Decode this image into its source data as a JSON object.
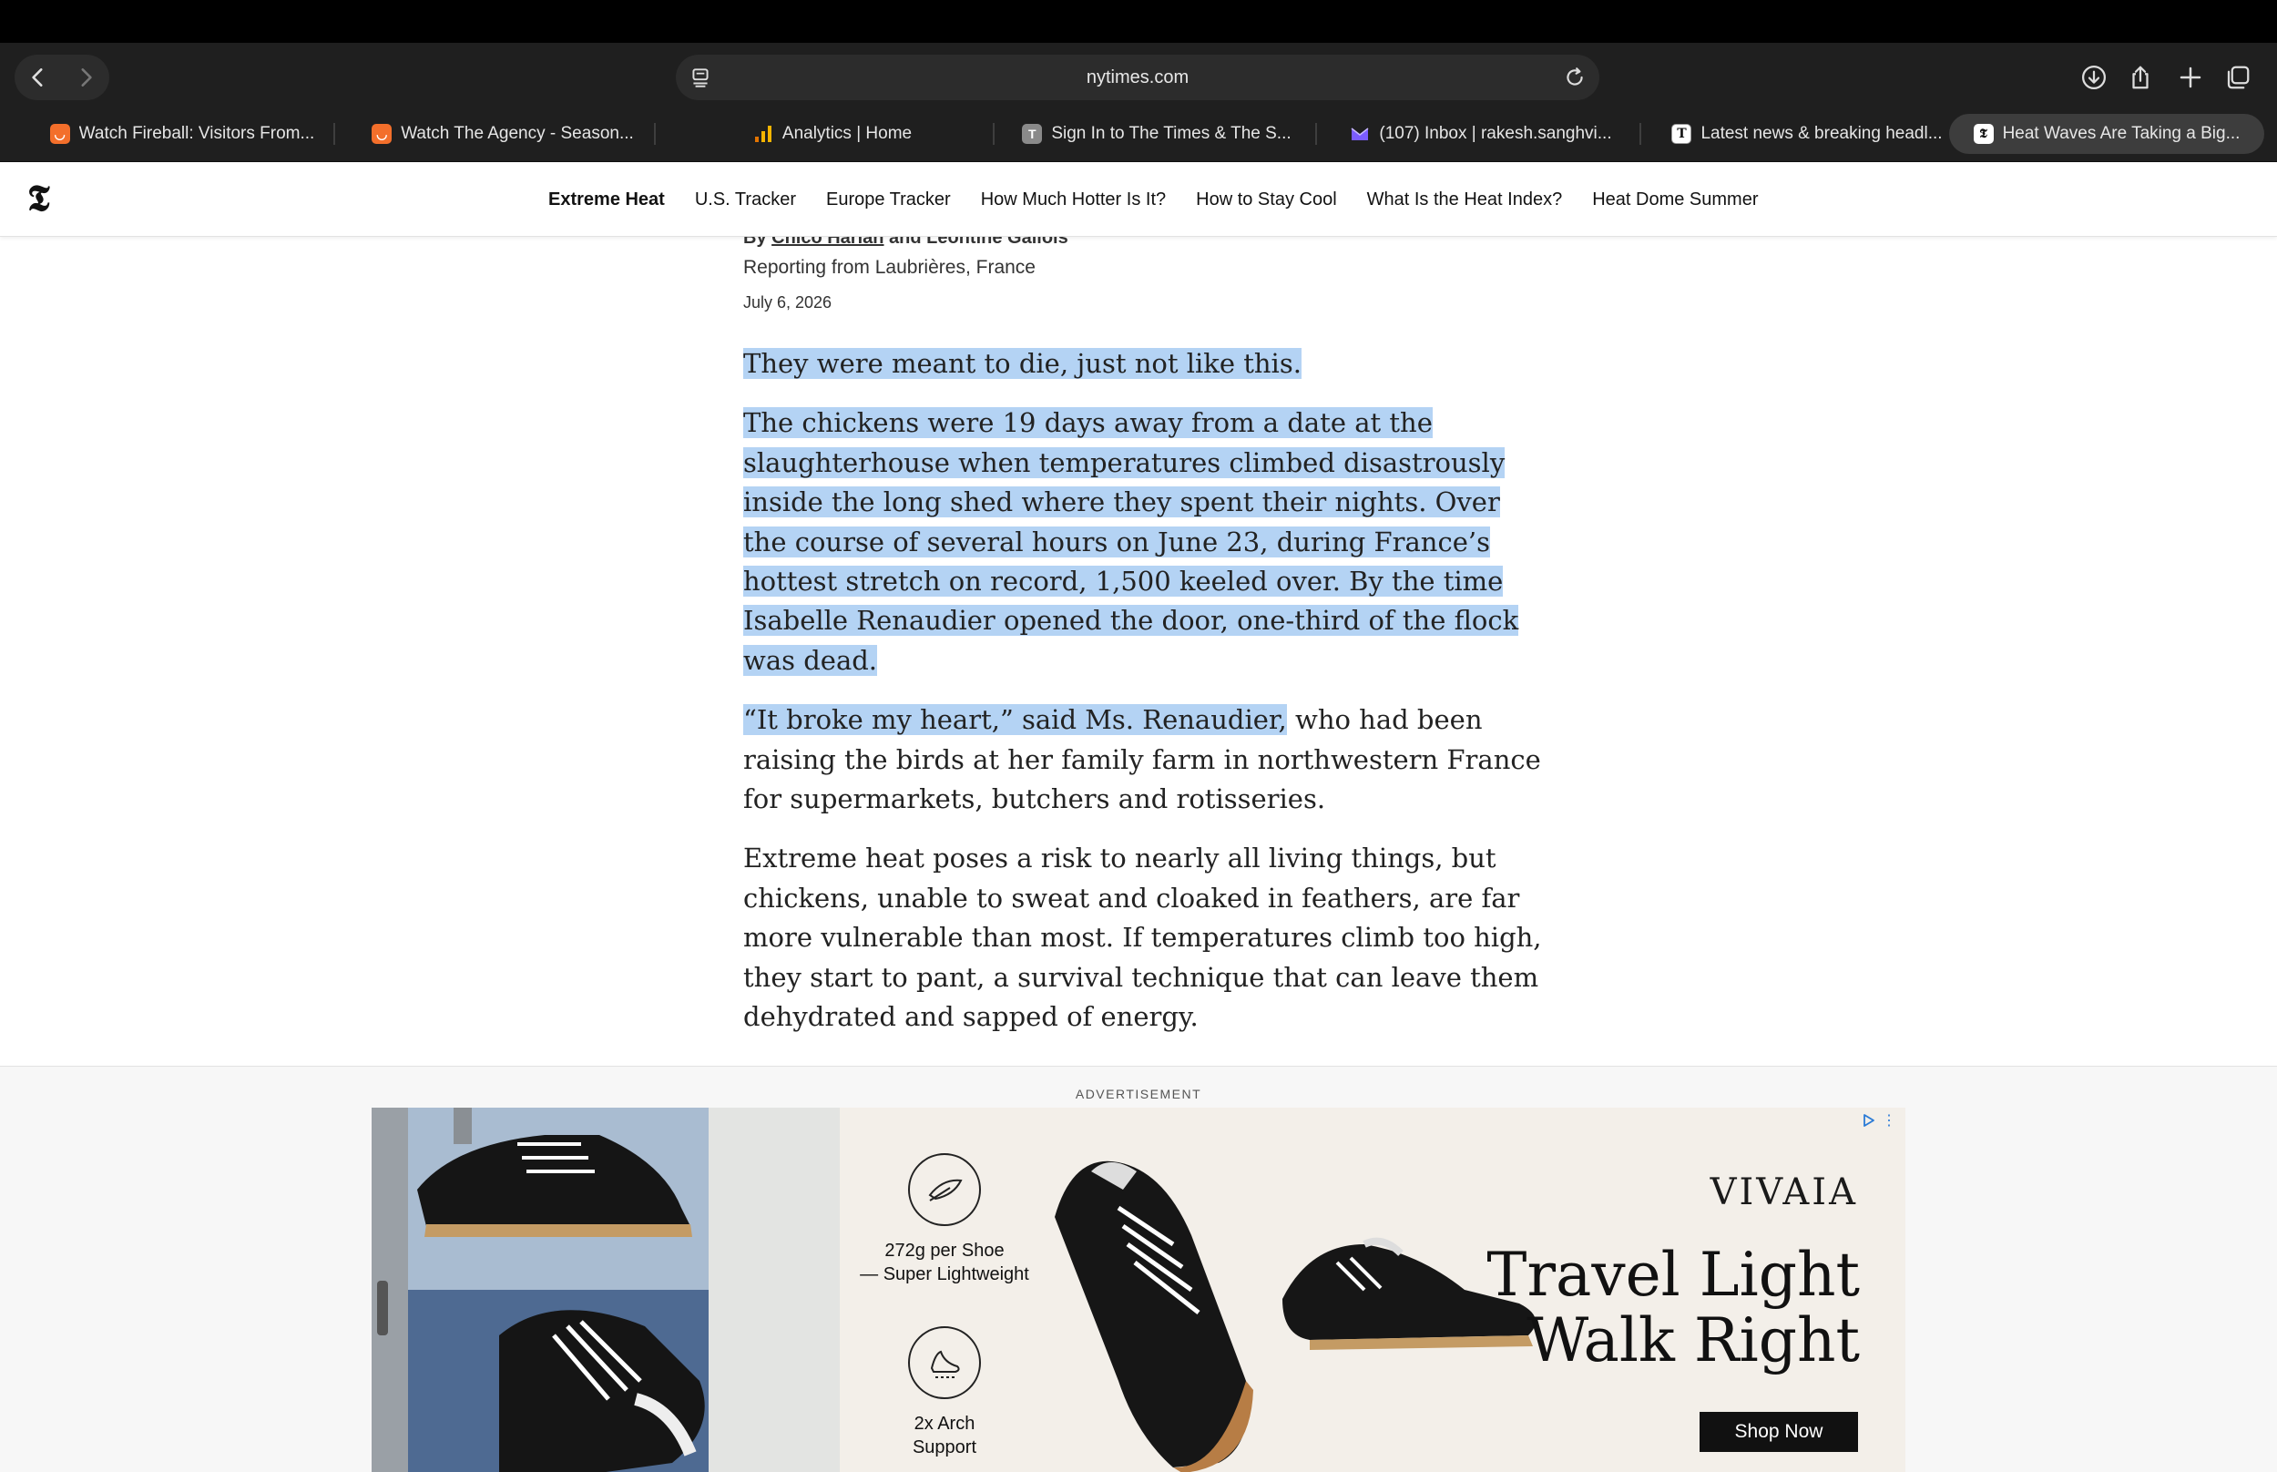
{
  "browser": {
    "url": "nytimes.com",
    "tabs": [
      {
        "label": "Watch Fireball: Visitors From...",
        "favicon": "orange-square-icon",
        "color": "#f36f2b",
        "active": false
      },
      {
        "label": "Watch The Agency - Season...",
        "favicon": "orange-square-icon",
        "color": "#f36f2b",
        "active": false
      },
      {
        "label": "Analytics | Home",
        "favicon": "analytics-bars-icon",
        "color": "#f4b400",
        "active": false
      },
      {
        "label": "Sign In to The Times & The S...",
        "favicon": "letter-t-icon",
        "color": "#8a8a8a",
        "active": false
      },
      {
        "label": "(107) Inbox | rakesh.sanghvi...",
        "favicon": "mail-m-icon",
        "color": "#7b5cff",
        "active": false
      },
      {
        "label": "Latest news & breaking headl...",
        "favicon": "letter-t-box-icon",
        "color": "#ffffff",
        "active": false
      },
      {
        "label": "Heat Waves Are Taking a Big...",
        "favicon": "nyt-logo-icon",
        "color": "#ffffff",
        "active": true
      }
    ]
  },
  "nyt_nav": {
    "links": [
      "Extreme Heat",
      "U.S. Tracker",
      "Europe Tracker",
      "How Much Hotter Is It?",
      "How to Stay Cool",
      "What Is the Heat Index?",
      "Heat Dome Summer"
    ]
  },
  "article": {
    "byline_prefix": "By ",
    "author1": "Chico Harlan",
    "byline_and": " and ",
    "author2": "Leontine Gallois",
    "reporting": "Reporting from Laubrières, France",
    "date": "July 6, 2026",
    "p1": "They were meant to die, just not like this.",
    "p2": "The chickens were 19 days away from a date at the slaughterhouse when temperatures climbed disastrously inside the long shed where they spent their nights. Over the course of several hours on June 23, during France’s hottest stretch on record, 1,500 keeled over. By the time Isabelle Renaudier opened the door, one-third of the flock was dead.",
    "p3_highlight": "“It broke my heart,” said Ms. Renaudier,",
    "p3_rest": " who had been raising the birds at her family farm in northwestern France for supermarkets, butchers and rotisseries.",
    "p4": "Extreme heat poses a risk to nearly all living things, but chickens, unable to sweat and cloaked in feathers, are far more vulnerable than most. If temperatures climb too high, they start to pant, a survival technique that can leave them dehydrated and sapped of energy.",
    "highlight_color": "#b4d3f4"
  },
  "ad": {
    "label": "ADVERTISEMENT",
    "brand": "VIVAIA",
    "headline_line1": "Travel Light",
    "headline_line2": "Walk Right",
    "cta": "Shop Now",
    "feature1": "272g per Shoe — Super Lightweight",
    "feature1_line1": "272g per Shoe",
    "feature1_line2": "— Super Lightweight",
    "feature2_line1": "2x Arch",
    "feature2_line2": "Support",
    "adchoices_icon": "adchoices-icon"
  }
}
